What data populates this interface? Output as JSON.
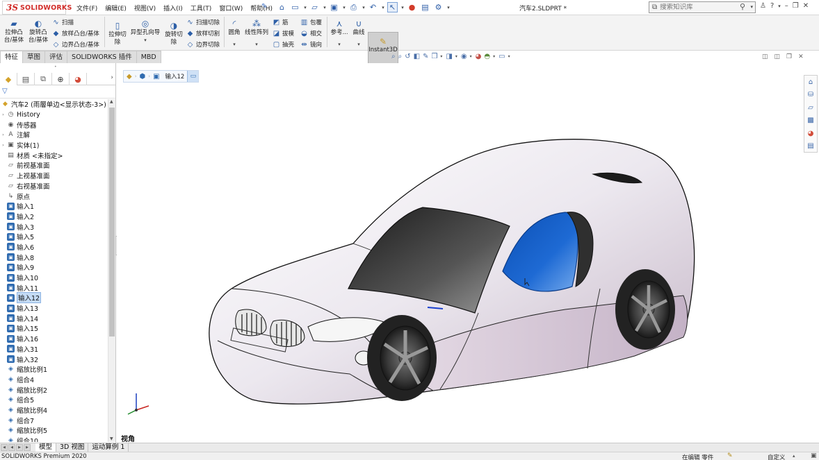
{
  "app": {
    "brand_ds": "3S",
    "brand_name": "SOLIDWORKS",
    "document_title": "汽车2.SLDPRT *"
  },
  "menu": [
    "文件(F)",
    "编辑(E)",
    "视图(V)",
    "插入(I)",
    "工具(T)",
    "窗口(W)",
    "帮助(H)"
  ],
  "search": {
    "placeholder": "搜索知识库"
  },
  "command_manager": {
    "extrude_boss": "拉伸凸\n台/基体",
    "revolve_boss": "旋转凸\n台/基体",
    "sweep": "扫描",
    "loft_boss": "放样凸台/基体",
    "boundary_boss": "边界凸台/基体",
    "extrude_cut": "拉伸切\n除",
    "hole_wizard": "异型孔向导",
    "revolve_cut": "旋转切\n除",
    "swept_cut": "扫描切除",
    "lofted_cut": "放样切割",
    "boundary_cut": "边界切除",
    "fillet": "圆角",
    "linear_pattern": "线性阵列",
    "rib": "筋",
    "draft": "拔模",
    "shell": "抽壳",
    "wrap": "包覆",
    "intersect": "相交",
    "mirror": "镜向",
    "reference": "参考...",
    "curves": "曲线",
    "instant3d": "Instant3D"
  },
  "tabs": [
    "特征",
    "草图",
    "评估",
    "SOLIDWORKS 插件",
    "MBD"
  ],
  "active_tab": "特征",
  "tree": {
    "root": "汽车2 (雨層单边<显示状态-3>)",
    "nodes": [
      {
        "label": "History",
        "icon": "history-icon",
        "expand": true
      },
      {
        "label": "传感器",
        "icon": "sensor-icon",
        "expand": false
      },
      {
        "label": "注解",
        "icon": "annotation-icon",
        "expand": true
      },
      {
        "label": "实体(1)",
        "icon": "solid-bodies-icon",
        "expand": true
      },
      {
        "label": "材质 <未指定>",
        "icon": "material-icon",
        "expand": false
      },
      {
        "label": "前视基准面",
        "icon": "plane-icon",
        "expand": false
      },
      {
        "label": "上视基准面",
        "icon": "plane-icon",
        "expand": false
      },
      {
        "label": "右视基准面",
        "icon": "plane-icon",
        "expand": false
      },
      {
        "label": "原点",
        "icon": "origin-icon",
        "expand": false
      },
      {
        "label": "输入1",
        "icon": "import-body-icon",
        "expand": false
      },
      {
        "label": "输入2",
        "icon": "import-body-icon",
        "expand": false
      },
      {
        "label": "输入3",
        "icon": "import-body-icon",
        "expand": false
      },
      {
        "label": "输入5",
        "icon": "import-body-icon",
        "expand": false
      },
      {
        "label": "输入6",
        "icon": "import-body-icon",
        "expand": false
      },
      {
        "label": "输入8",
        "icon": "import-body-icon",
        "expand": false
      },
      {
        "label": "输入9",
        "icon": "import-body-icon",
        "expand": false
      },
      {
        "label": "输入10",
        "icon": "import-body-icon",
        "expand": false
      },
      {
        "label": "输入11",
        "icon": "import-body-icon",
        "expand": false
      },
      {
        "label": "输入12",
        "icon": "import-body-icon",
        "expand": false,
        "selected": true
      },
      {
        "label": "输入13",
        "icon": "import-body-icon",
        "expand": false
      },
      {
        "label": "输入14",
        "icon": "import-body-icon",
        "expand": false
      },
      {
        "label": "输入15",
        "icon": "import-body-icon",
        "expand": false
      },
      {
        "label": "输入16",
        "icon": "import-body-icon",
        "expand": false
      },
      {
        "label": "输入31",
        "icon": "import-body-icon",
        "expand": false
      },
      {
        "label": "输入32",
        "icon": "import-body-icon",
        "expand": false
      },
      {
        "label": "缩放比例1",
        "icon": "scale-icon",
        "expand": false
      },
      {
        "label": "组合4",
        "icon": "combine-icon",
        "expand": false
      },
      {
        "label": "缩放比例2",
        "icon": "scale-icon",
        "expand": false
      },
      {
        "label": "组合5",
        "icon": "combine-icon",
        "expand": false
      },
      {
        "label": "缩放比例4",
        "icon": "scale-icon",
        "expand": false
      },
      {
        "label": "组合7",
        "icon": "combine-icon",
        "expand": false
      },
      {
        "label": "缩放比例5",
        "icon": "scale-icon",
        "expand": false
      },
      {
        "label": "组合10",
        "icon": "combine-icon",
        "expand": false
      }
    ]
  },
  "breadcrumb": {
    "label": "输入12"
  },
  "viewport": {
    "view_label": "视角"
  },
  "bottom_tabs": [
    "模型",
    "3D 视图",
    "运动算例 1"
  ],
  "active_bottom_tab": "模型",
  "status": {
    "product": "SOLIDWORKS Premium 2020",
    "editing": "在编辑 零件",
    "units": "自定义"
  },
  "colors": {
    "brand_red": "#d12b27",
    "accent_blue": "#2f6bb0",
    "highlight_blue": "#1c62c8"
  }
}
